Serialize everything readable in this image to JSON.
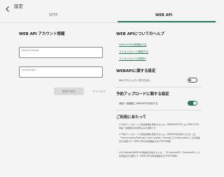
{
  "header": {
    "title": "設定"
  },
  "tabs": [
    {
      "label": "SFTP"
    },
    {
      "label": "WEB API"
    }
  ],
  "account": {
    "heading": "WEB API アカウント情報",
    "secret_label": "Service Secret",
    "license_label": "License Key",
    "save_label": "接続を保存",
    "cancel_label": "キャンセル"
  },
  "help": {
    "heading": "WEB APIについてのヘルプ",
    "links": [
      "WEB APIの利用開始方法",
      "ライセンスキーの確認方法",
      "ライセンスキーの再発行"
    ]
  },
  "webapi_settings": {
    "heading": "WEBAPIに関する設定",
    "option_label": "SKUプロジェクト名付き出し",
    "enabled": false
  },
  "reservation_settings": {
    "heading": "予約アップロードに関する設定",
    "option_label": "商品一括機能にWEBAPIを利用する",
    "enabled": true
  },
  "notes": {
    "heading": "ご利用にあたって",
    "paragraphs": [
      "※ 予約アップロードで商品情報を更新するには、WEBAPI/SFTPともにRMSでCSV商品一括機能の利用申込みが必要です",
      "※ 予約アップロードで商品情報を更新するには、WEBAPIを利用するため ご注「license.expiryDate.get / item.update / itemapi_2.0.items.patch」の利用設定が必要です（WEB APIの利用開始方法 STEP3参照）",
      "※R-CabinetのWEB API情報を利用するには、「R-CabinetAPI（CabinetAPI）」の利用設定が必要です（WEB APIの利用開始方法 STEP3参照）"
    ]
  },
  "colors": {
    "accent": "#2a7b57",
    "background": "#f4f4f4"
  }
}
